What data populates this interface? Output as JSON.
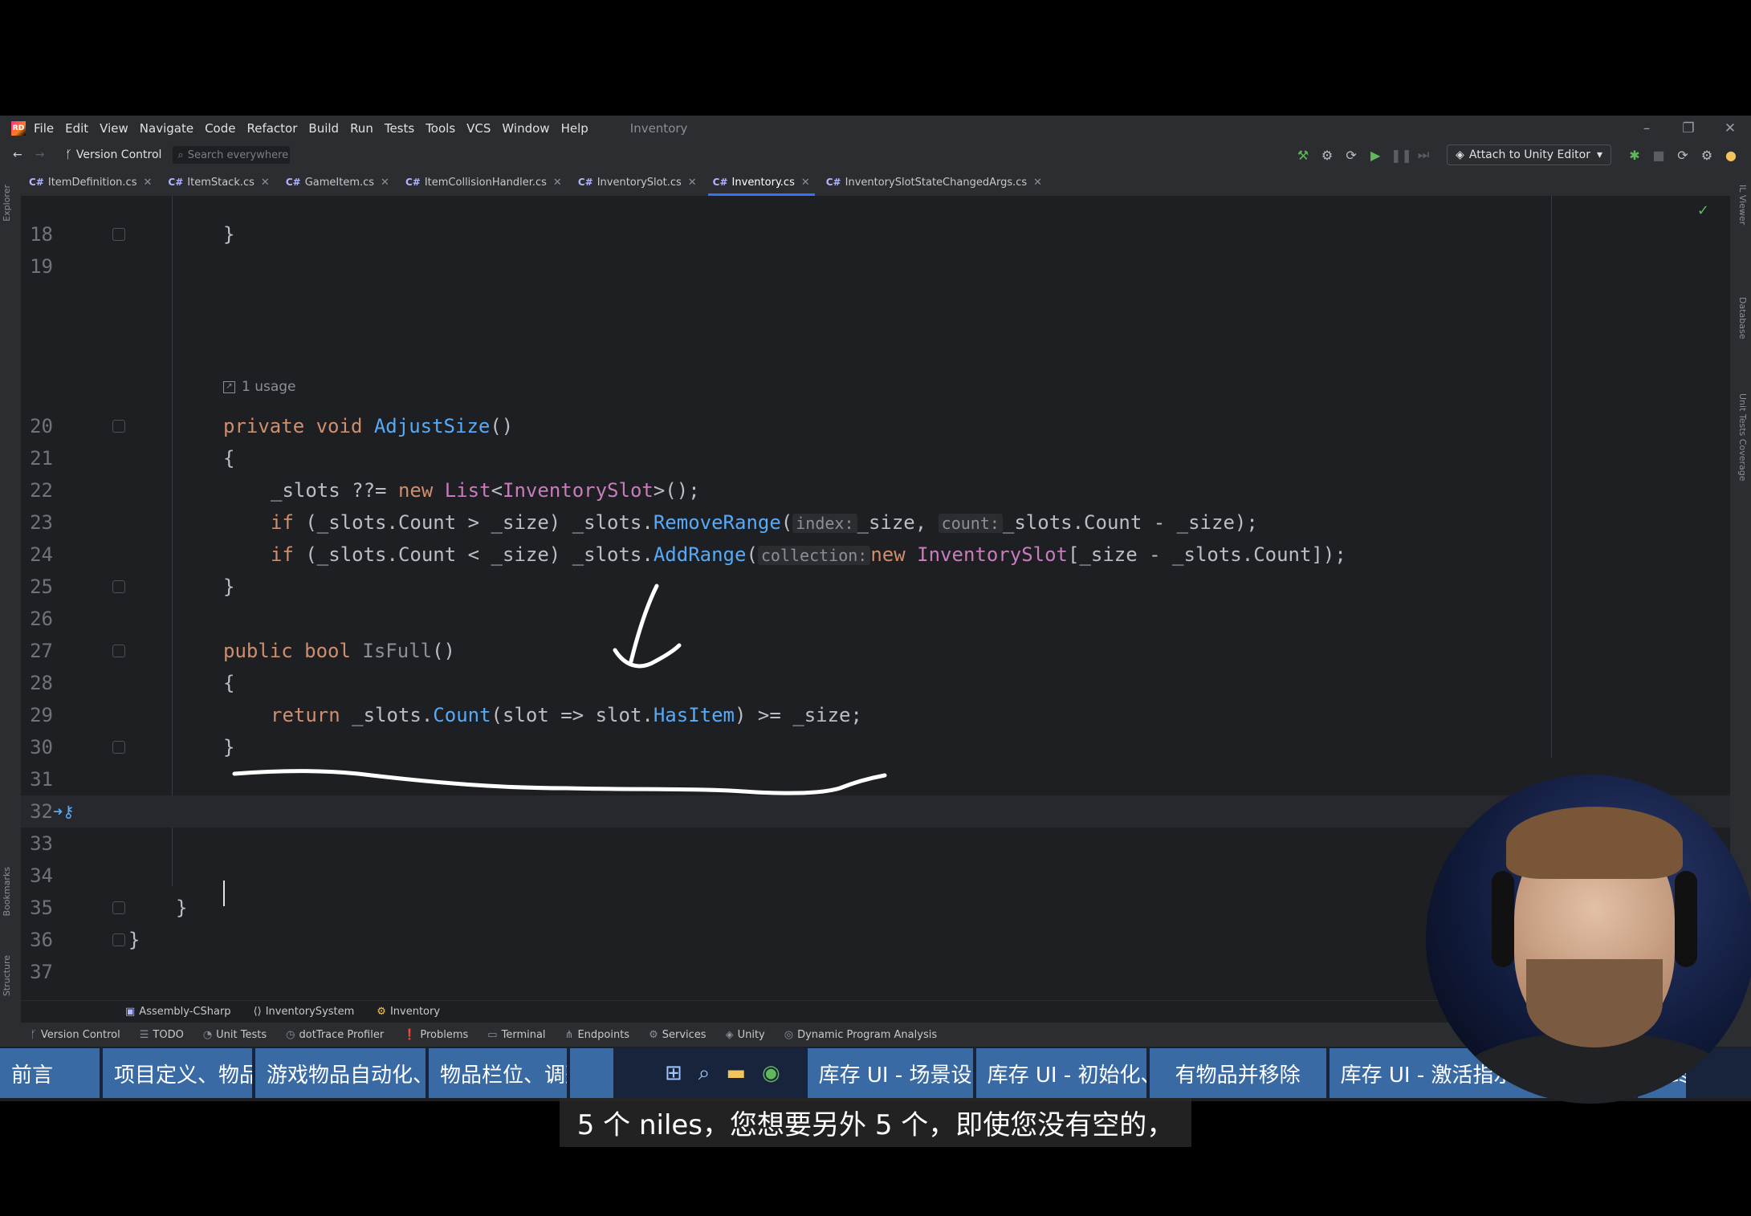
{
  "menubar": {
    "items": [
      "File",
      "Edit",
      "View",
      "Navigate",
      "Code",
      "Refactor",
      "Build",
      "Run",
      "Tests",
      "Tools",
      "VCS",
      "Window",
      "Help"
    ],
    "project": "Inventory"
  },
  "toolbar": {
    "version_control": "Version Control",
    "search_placeholder": "Search everywhere",
    "attach_label": "Attach to Unity Editor"
  },
  "tabs": [
    {
      "label": "ItemDefinition.cs"
    },
    {
      "label": "ItemStack.cs"
    },
    {
      "label": "GameItem.cs"
    },
    {
      "label": "ItemCollisionHandler.cs"
    },
    {
      "label": "InventorySlot.cs"
    },
    {
      "label": "Inventory.cs"
    },
    {
      "label": "InventorySlotStateChangedArgs.cs"
    }
  ],
  "tab_lang": "C#",
  "left_strip": {
    "explorer": "Explorer",
    "bookmarks": "Bookmarks",
    "structure": "Structure"
  },
  "right_strip": {
    "il_viewer": "IL Viewer",
    "database": "Database",
    "coverage": "Unit Tests Coverage"
  },
  "editor": {
    "usage_hint": "1 usage",
    "line_numbers": [
      "18",
      "19",
      "20",
      "21",
      "22",
      "23",
      "24",
      "25",
      "26",
      "27",
      "28",
      "29",
      "30",
      "31",
      "32",
      "33",
      "34",
      "35",
      "36",
      "37"
    ],
    "hint_index": "index:",
    "hint_count": "count:",
    "hint_collection": "collection:"
  },
  "breadcrumbs": [
    "Assembly-CSharp",
    "InventorySystem",
    "Inventory"
  ],
  "statusbar": [
    "Version Control",
    "TODO",
    "Unit Tests",
    "dotTrace Profiler",
    "Problems",
    "Terminal",
    "Endpoints",
    "Services",
    "Unity",
    "Dynamic Program Analysis"
  ],
  "chapters": [
    "前言",
    "项目定义、物品",
    "游戏物品自动化、",
    "物品栏位、调整尺",
    "",
    "库存 UI - 场景设",
    "库存 UI - 初始化、",
    "有物品并移除",
    "库存 UI - 激活指示器、投掷物品",
    "最终"
  ],
  "subtitle": "5 个 niles，您想要另外 5 个，即使您没有空的，"
}
